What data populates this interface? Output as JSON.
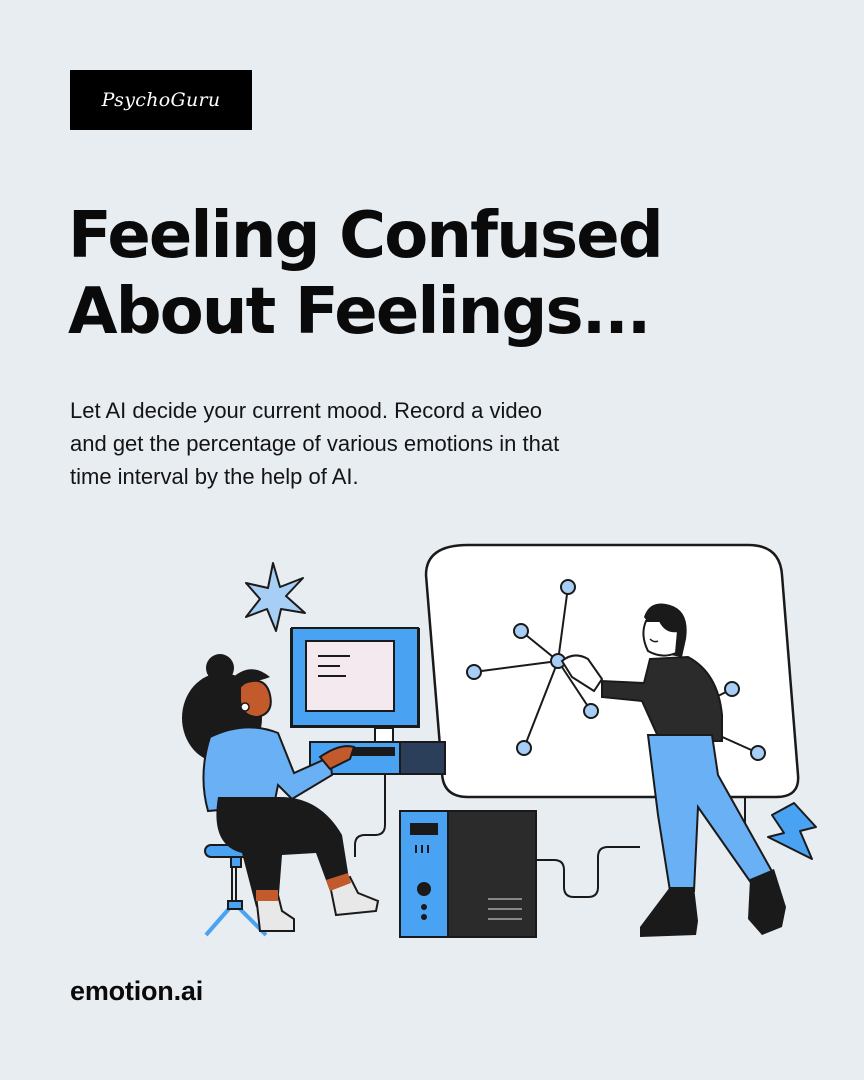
{
  "logo": {
    "text": "PsychoGuru"
  },
  "headline": {
    "line1": "Feeling Confused",
    "line2": "About Feelings..."
  },
  "description": "Let AI decide your current mood. Record a video and get the percentage of various emotions in that time interval by the help of AI.",
  "footer": {
    "brand": "emotion.ai"
  },
  "colors": {
    "background": "#e8edf2",
    "accent_blue": "#5aa8f5",
    "dark": "#1a1a1a"
  }
}
